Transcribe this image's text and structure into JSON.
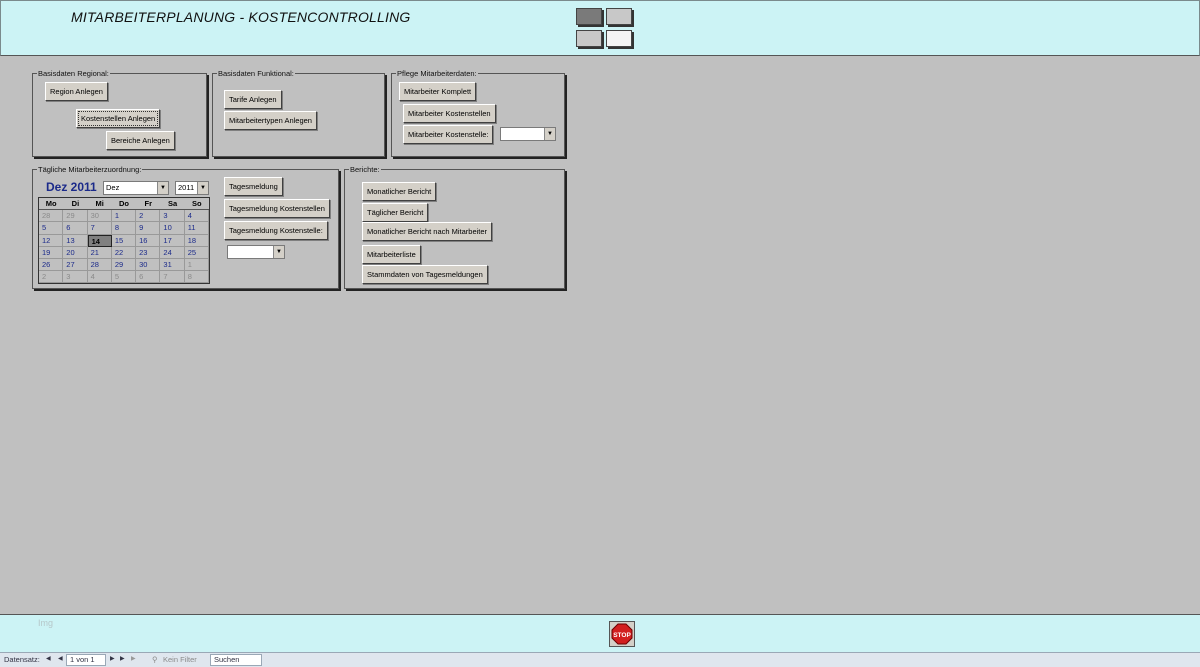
{
  "header": {
    "title": "MITARBEITERPLANUNG - KOSTENCONTROLLING"
  },
  "groups": {
    "regional": {
      "label": "Basisdaten Regional:",
      "buttons": [
        "Region Anlegen",
        "Kostenstellen Anlegen",
        "Bereiche Anlegen"
      ]
    },
    "funktional": {
      "label": "Basisdaten Funktional:",
      "buttons": [
        "Tarife Anlegen",
        "Mitarbeitertypen Anlegen"
      ]
    },
    "pflege": {
      "label": "Pflege Mitarbeiterdaten:",
      "buttons": [
        "Mitarbeiter Komplett",
        "Mitarbeiter Kostenstellen",
        "Mitarbeiter Kostenstelle:"
      ]
    },
    "taeglich": {
      "label": "Tägliche Mitarbeiterzuordnung:",
      "buttons": [
        "Tagesmeldung",
        "Tagesmeldung Kostenstellen",
        "Tagesmeldung Kostenstelle:"
      ]
    },
    "berichte": {
      "label": "Berichte:",
      "buttons": [
        "Monatlicher Bericht",
        "Täglicher Bericht",
        "Monatlicher Bericht nach Mitarbeiter",
        "Mitarbeiterliste",
        "Stammdaten von Tagesmeldungen"
      ]
    }
  },
  "calendar": {
    "title": "Dez 2011",
    "month_select": "Dez",
    "year_select": "2011",
    "weekdays": [
      "Mo",
      "Di",
      "Mi",
      "Do",
      "Fr",
      "Sa",
      "So"
    ],
    "weeks": [
      [
        [
          "28",
          1
        ],
        [
          "29",
          1
        ],
        [
          "30",
          1
        ],
        [
          "1",
          0
        ],
        [
          "2",
          0
        ],
        [
          "3",
          0
        ],
        [
          "4",
          0
        ]
      ],
      [
        [
          "5",
          0
        ],
        [
          "6",
          0
        ],
        [
          "7",
          0
        ],
        [
          "8",
          0
        ],
        [
          "9",
          0
        ],
        [
          "10",
          0
        ],
        [
          "11",
          0
        ]
      ],
      [
        [
          "12",
          0
        ],
        [
          "13",
          0
        ],
        [
          "14",
          2
        ],
        [
          "15",
          0
        ],
        [
          "16",
          0
        ],
        [
          "17",
          0
        ],
        [
          "18",
          0
        ]
      ],
      [
        [
          "19",
          0
        ],
        [
          "20",
          0
        ],
        [
          "21",
          0
        ],
        [
          "22",
          0
        ],
        [
          "23",
          0
        ],
        [
          "24",
          0
        ],
        [
          "25",
          0
        ]
      ],
      [
        [
          "26",
          0
        ],
        [
          "27",
          0
        ],
        [
          "28",
          0
        ],
        [
          "29",
          0
        ],
        [
          "30",
          0
        ],
        [
          "31",
          0
        ],
        [
          "1",
          1
        ]
      ],
      [
        [
          "2",
          1
        ],
        [
          "3",
          1
        ],
        [
          "4",
          1
        ],
        [
          "5",
          1
        ],
        [
          "6",
          1
        ],
        [
          "7",
          1
        ],
        [
          "8",
          1
        ]
      ]
    ]
  },
  "footer": {
    "ghost_text": "Img"
  },
  "statusbar": {
    "record_label": "Datensatz:",
    "record_nav_first": "◀",
    "record_nav_prev": "◀",
    "record_value": "1 von 1",
    "record_nav_next": "▶",
    "record_nav_last": "▶",
    "record_nav_new": "▶",
    "filter": "Kein Filter",
    "search": "Suchen"
  }
}
